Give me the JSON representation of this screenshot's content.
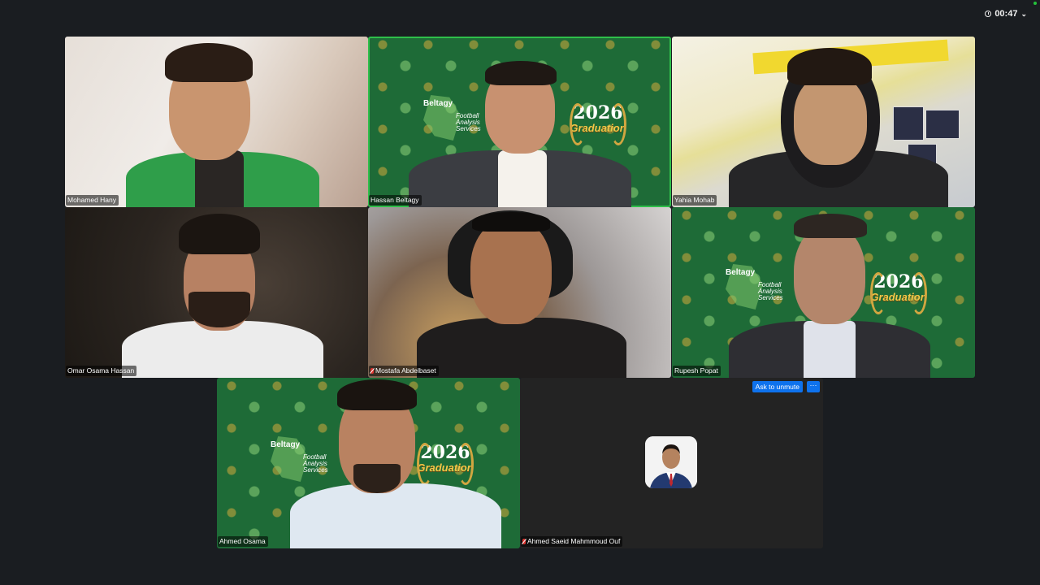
{
  "meeting": {
    "timer": "00:47",
    "timer_icon": "clock-icon",
    "timer_menu_icon": "chevron-down-icon",
    "connection_status_color": "#24c23b"
  },
  "participants": [
    {
      "name": "Mohamed Hany",
      "muted": false
    },
    {
      "name": "Hassan Beltagy",
      "muted": false,
      "active_speaker": true
    },
    {
      "name": "Yahia Mohab",
      "muted": false
    },
    {
      "name": "Omar Osama Hassan",
      "muted": false
    },
    {
      "name": "Mostafa Abdelbaset",
      "muted": true
    },
    {
      "name": "Rupesh Popat",
      "muted": false
    },
    {
      "name": "Ahmed Osama",
      "muted": false
    },
    {
      "name": "Ahmed Saeid Mahmmoud Ouf",
      "muted": true,
      "video_off": true
    }
  ],
  "virtual_background": {
    "brand": "Beltagy",
    "brand_sub": "Football Analysis Services",
    "year_top": "20",
    "year_bottom": "26",
    "event": "Graduation",
    "color": "#1e6b37"
  },
  "controls": {
    "ask_to_unmute_label": "Ask to unmute",
    "more_label": "···"
  },
  "colors": {
    "background": "#1a1d21",
    "active_speaker_border": "#2fbf4a",
    "button_blue": "#0e72ed",
    "muted_red": "#e0342f"
  }
}
